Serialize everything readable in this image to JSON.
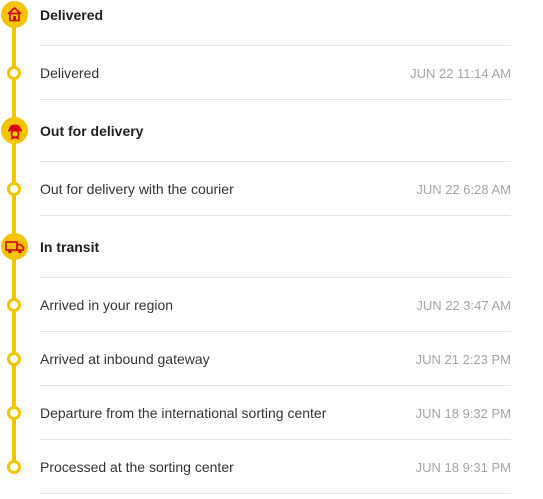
{
  "colors": {
    "accent": "#f5c400",
    "icon": "#d40511",
    "divider": "#e3e3e3",
    "timestamp": "#a4a4a4"
  },
  "groups": [
    {
      "title": "Delivered",
      "icon": "house-icon",
      "events": [
        {
          "text": "Delivered",
          "time": "JUN 22 11:14 AM"
        }
      ]
    },
    {
      "title": "Out for delivery",
      "icon": "courier-icon",
      "events": [
        {
          "text": "Out for delivery with the courier",
          "time": "JUN 22 6:28 AM"
        }
      ]
    },
    {
      "title": "In transit",
      "icon": "truck-icon",
      "events": [
        {
          "text": "Arrived in your region",
          "time": "JUN 22 3:47 AM"
        },
        {
          "text": "Arrived at inbound gateway",
          "time": "JUN 21 2:23 PM"
        },
        {
          "text": "Departure from the international sorting center",
          "time": "JUN 18 9:32 PM"
        },
        {
          "text": "Processed at the sorting center",
          "time": "JUN 18 9:31 PM"
        }
      ]
    }
  ]
}
